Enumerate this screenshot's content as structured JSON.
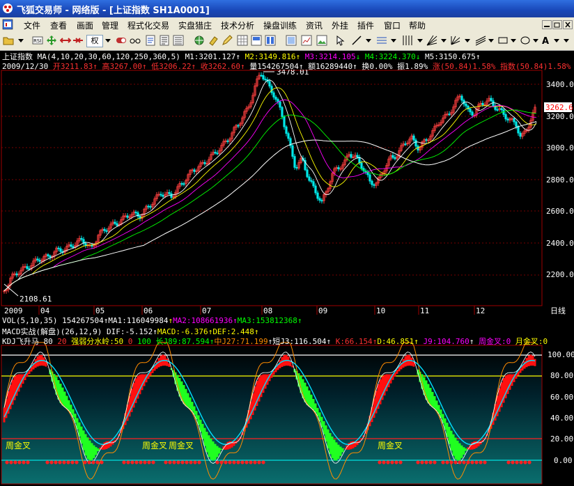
{
  "window": {
    "title": "飞狐交易师 - 网络版 - [上证指数 SH1A0001]"
  },
  "menu": [
    "文件",
    "查看",
    "画面",
    "管理",
    "程式化交易",
    "实盘猎庄",
    "技术分析",
    "操盘训练",
    "资讯",
    "外挂",
    "插件",
    "窗口",
    "帮助"
  ],
  "toolbar": {
    "weight_label": "权"
  },
  "header_line1": {
    "name": "上证指数",
    "ma_params": "MA(4,10,20,30,60,120,250,360,5)",
    "m1": "M1:3201.127",
    "m2": "M2:3149.816",
    "m3": "M3:3214.105",
    "m4": "M4:3224.370",
    "m5": "M5:3150.675"
  },
  "header_line2": {
    "date": "2009/12/30",
    "open": "开3211.83",
    "high": "高3267.00",
    "low": "低3206.22",
    "close": "收3262.60",
    "volume": "量154267504",
    "amount": "额16289440",
    "turnover": "换0.00%",
    "amplitude": "振1.89%",
    "change": "涨(50.84)1.58%",
    "index_change": "指数(50.84)1.58%"
  },
  "price_axis": {
    "labels": [
      "3400.0",
      "3200.0",
      "3000.0",
      "2800.0",
      "2600.0",
      "2400.0",
      "2200.0"
    ],
    "current": "3262.6"
  },
  "annotations": {
    "high_marker": "3478.01",
    "low_marker": "2108.61"
  },
  "time_axis": {
    "labels": [
      "2009",
      "04",
      "05",
      "06",
      "07",
      "08",
      "09",
      "10",
      "11",
      "12"
    ],
    "period": "日线"
  },
  "vol_line": {
    "params": "VOL(5,10,35)",
    "value": "154267504",
    "ma1": "MA1:116049984",
    "ma2": "MA2:108661936",
    "ma3": "MA3:153812368"
  },
  "macd_line": {
    "name": "MACD实战(解盘)(26,12,9)",
    "dif": "DIF:-5.152",
    "macd": "MACD:-6.376",
    "def": "DEF:2.448"
  },
  "kdj_line": {
    "name": "KDJ飞升马",
    "p1": "80",
    "p2": "20",
    "strong": "强弱分水岭:50",
    "zero": "0",
    "hundred": "100",
    "chang": "长J89:87.594",
    "zhong": "中J27:71.199",
    "duan": "短J3:116.504",
    "k": "K:66.154",
    "d": "D:46.851",
    "j": "J9:104.760",
    "zhou": "周金叉:0",
    "yue": "月金叉:0"
  },
  "osc_axis": {
    "labels": [
      "100.00",
      "80.00",
      "60.00",
      "40.00",
      "20.00",
      "0.00"
    ]
  },
  "signals": {
    "weekly_cross": "周金叉"
  },
  "chart_data": {
    "type": "line",
    "title": "上证指数 SH1A0001",
    "ylim": [
      2050,
      3560
    ],
    "close_points": [
      [
        0,
        2110
      ],
      [
        10,
        2190
      ],
      [
        20,
        2230
      ],
      [
        35,
        2260
      ],
      [
        50,
        2310
      ],
      [
        62,
        2320
      ],
      [
        75,
        2360
      ],
      [
        88,
        2370
      ],
      [
        100,
        2400
      ],
      [
        112,
        2430
      ],
      [
        125,
        2370
      ],
      [
        135,
        2460
      ],
      [
        150,
        2510
      ],
      [
        165,
        2540
      ],
      [
        180,
        2590
      ],
      [
        195,
        2580
      ],
      [
        210,
        2650
      ],
      [
        225,
        2720
      ],
      [
        240,
        2700
      ],
      [
        255,
        2780
      ],
      [
        270,
        2860
      ],
      [
        285,
        2900
      ],
      [
        300,
        2960
      ],
      [
        312,
        3010
      ],
      [
        325,
        3080
      ],
      [
        340,
        3180
      ],
      [
        350,
        3250
      ],
      [
        360,
        3380
      ],
      [
        368,
        3478
      ],
      [
        378,
        3400
      ],
      [
        388,
        3330
      ],
      [
        398,
        3220
      ],
      [
        408,
        3050
      ],
      [
        418,
        2880
      ],
      [
        428,
        2930
      ],
      [
        438,
        2800
      ],
      [
        448,
        2720
      ],
      [
        456,
        2660
      ],
      [
        463,
        2740
      ],
      [
        470,
        2830
      ],
      [
        478,
        2880
      ],
      [
        488,
        2900
      ],
      [
        495,
        2970
      ],
      [
        505,
        2940
      ],
      [
        515,
        2880
      ],
      [
        525,
        2790
      ],
      [
        535,
        2780
      ],
      [
        545,
        2870
      ],
      [
        555,
        2940
      ],
      [
        565,
        2960
      ],
      [
        575,
        3040
      ],
      [
        585,
        3060
      ],
      [
        595,
        3000
      ],
      [
        605,
        3050
      ],
      [
        615,
        3100
      ],
      [
        625,
        3170
      ],
      [
        635,
        3200
      ],
      [
        645,
        3260
      ],
      [
        655,
        3340
      ],
      [
        665,
        3230
      ],
      [
        675,
        3220
      ],
      [
        685,
        3280
      ],
      [
        695,
        3300
      ],
      [
        705,
        3260
      ],
      [
        715,
        3220
      ],
      [
        725,
        3180
      ],
      [
        735,
        3150
      ],
      [
        742,
        3060
      ],
      [
        750,
        3120
      ],
      [
        758,
        3200
      ],
      [
        764,
        3262
      ]
    ]
  }
}
